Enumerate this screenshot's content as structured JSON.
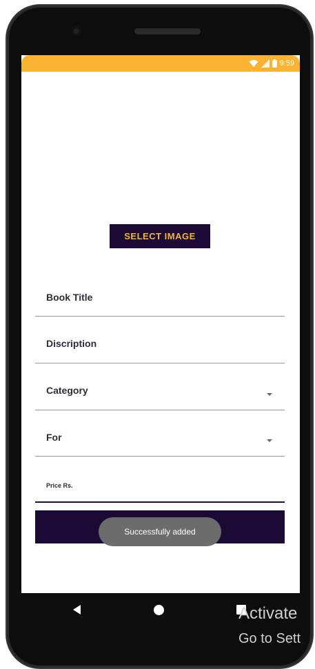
{
  "status_bar": {
    "time": "9:59",
    "icons": [
      "wifi-icon",
      "signal-icon",
      "battery-icon"
    ],
    "color": "#f9b233"
  },
  "form": {
    "select_image_label": "SELECT IMAGE",
    "book_title_placeholder": "Book Title",
    "description_placeholder": "Discription",
    "category_label": "Category",
    "for_label": "For",
    "price_placeholder": "Price Rs.",
    "submit_label": ""
  },
  "toast": {
    "message": "Successfully added"
  },
  "nav_bar": {
    "icons": [
      "back-icon",
      "home-icon",
      "recents-icon"
    ]
  },
  "watermark": {
    "line1": "Activate",
    "line2": "Go to Sett"
  },
  "colors": {
    "accent_dark": "#1b0a36",
    "accent_gold": "#f3b62e",
    "status_bar": "#f9b233",
    "toast_bg": "#6c6c6c"
  }
}
